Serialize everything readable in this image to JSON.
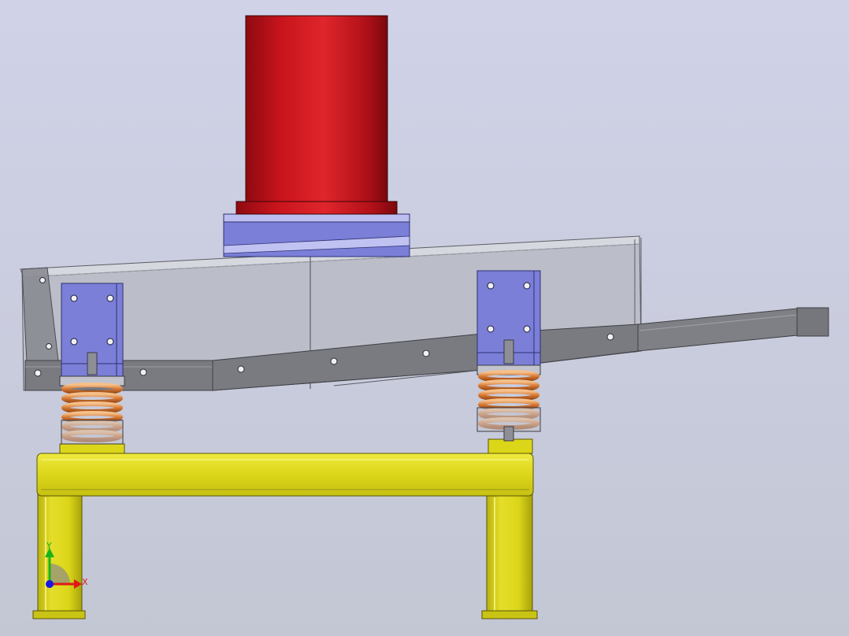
{
  "viewport": {
    "background_top": "#d0d2e8",
    "background_bottom": "#c3c7d4"
  },
  "colors": {
    "motor_red": "#c8141c",
    "bracket_blue": "#7b7fd8",
    "frame_yellow": "#dcd619",
    "spring_copper": "#d77a36",
    "trough_gray": "#b8bac4",
    "trough_dark": "#77787c"
  },
  "triad": {
    "y_label": "Y",
    "x_label": "X",
    "y_color": "#18b418",
    "x_color": "#e01818",
    "z_color": "#1818e0"
  }
}
